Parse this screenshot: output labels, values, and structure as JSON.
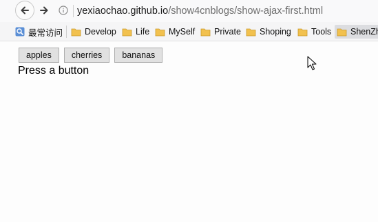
{
  "browser": {
    "url_host": "yexiaochao.github.io",
    "url_path": "/show4cnblogs/show-ajax-first.html"
  },
  "bookmarks": {
    "items": [
      {
        "label": "最常访问",
        "icon": "globe-search-icon"
      },
      {
        "label": "Develop",
        "icon": "folder-icon"
      },
      {
        "label": "Life",
        "icon": "folder-icon"
      },
      {
        "label": "MySelf",
        "icon": "folder-icon"
      },
      {
        "label": "Private",
        "icon": "folder-icon"
      },
      {
        "label": "Shoping",
        "icon": "folder-icon"
      },
      {
        "label": "Tools",
        "icon": "folder-icon"
      },
      {
        "label": "ShenZh",
        "icon": "folder-icon"
      }
    ]
  },
  "page": {
    "buttons": [
      "apples",
      "cherries",
      "bananas"
    ],
    "status": "Press a button"
  },
  "colors": {
    "folder": "#f2c14e",
    "button_bg": "#e1e1e1",
    "button_border": "#adadad"
  }
}
